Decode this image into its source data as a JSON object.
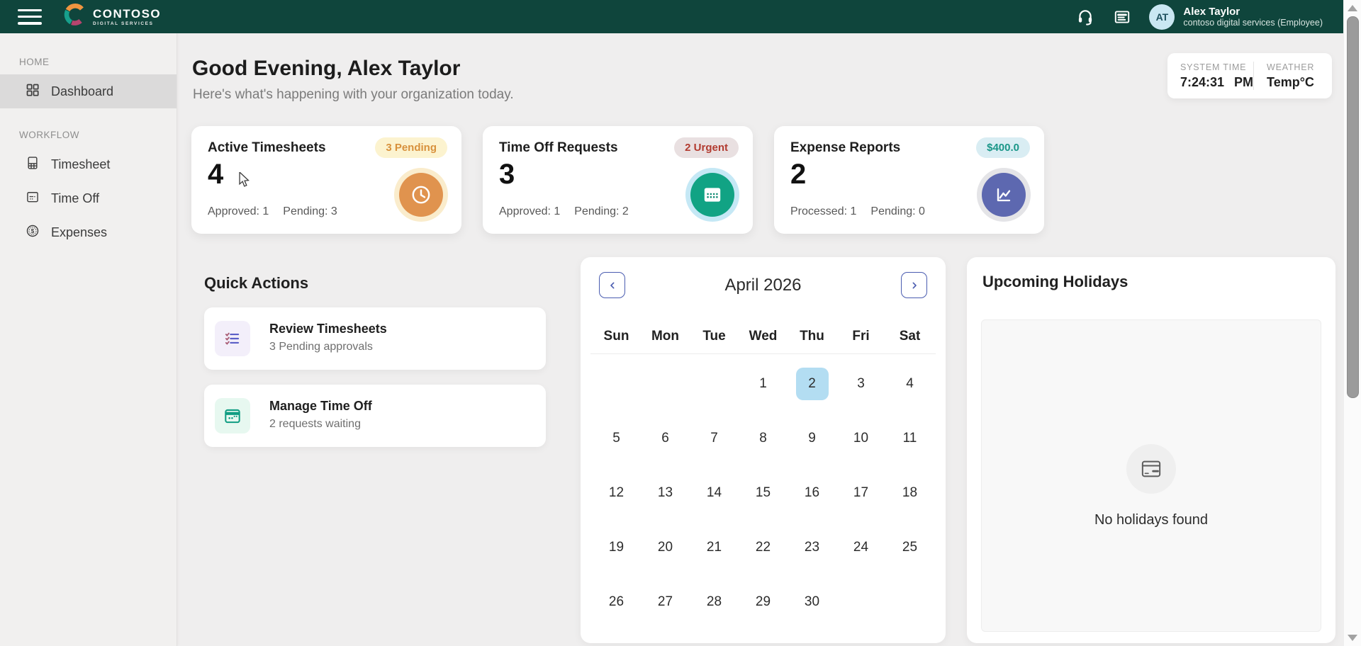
{
  "topbar": {
    "logo_name": "CONTOSO",
    "logo_tagline": "DIGITAL SERVICES",
    "user": {
      "initials": "AT",
      "name": "Alex Taylor",
      "role": "contoso digital services (Employee)"
    }
  },
  "sidebar": {
    "sections": [
      {
        "label": "HOME"
      },
      {
        "label": "WORKFLOW"
      }
    ],
    "items": {
      "dashboard": "Dashboard",
      "timesheet": "Timesheet",
      "timeoff": "Time Off",
      "expenses": "Expenses"
    }
  },
  "header": {
    "greeting": "Good Evening, Alex Taylor",
    "subtitle": "Here's what's happening with your organization today."
  },
  "status_widget": {
    "system_time_label": "SYSTEM TIME",
    "time_value": "7:24:31",
    "meridiem": "PM",
    "weather_label": "WEATHER",
    "weather_value": "Temp°C"
  },
  "stat_cards": [
    {
      "title": "Active Timesheets",
      "badge": "3 Pending",
      "badge_bg": "#fcf3cf",
      "badge_color": "#d8913c",
      "value": "4",
      "detail_left": "Approved: 1",
      "detail_right": "Pending: 3",
      "icon": "clock-icon",
      "icon_bg": "#e0934e",
      "ring": "rgba(245,221,163,0.55)"
    },
    {
      "title": "Time Off Requests",
      "badge": "2 Urgent",
      "badge_bg": "#e9e0e1",
      "badge_color": "#b23b30",
      "value": "3",
      "detail_left": "Approved: 1",
      "detail_right": "Pending: 2",
      "icon": "calendar-icon",
      "icon_bg": "#11a384",
      "ring": "rgba(158,217,238,0.6)"
    },
    {
      "title": "Expense Reports",
      "badge": "$400.0",
      "badge_bg": "#d9edf3",
      "badge_color": "#1a9688",
      "value": "2",
      "detail_left": "Processed: 1",
      "detail_right": "Pending: 0",
      "icon": "chart-icon",
      "icon_bg": "#5d68b0",
      "ring": "rgba(206,206,212,0.55)"
    }
  ],
  "quick_actions": {
    "title": "Quick Actions",
    "items": [
      {
        "title": "Review Timesheets",
        "subtitle": "3 Pending approvals",
        "icon": "checklist-icon"
      },
      {
        "title": "Manage Time Off",
        "subtitle": "2 requests waiting",
        "icon": "calendar-plus-icon"
      }
    ]
  },
  "calendar": {
    "title": "April 2026",
    "day_headers": [
      "Sun",
      "Mon",
      "Tue",
      "Wed",
      "Thu",
      "Fri",
      "Sat"
    ],
    "weeks": [
      [
        null,
        null,
        null,
        1,
        2,
        3,
        4
      ],
      [
        5,
        6,
        7,
        8,
        9,
        10,
        11
      ],
      [
        12,
        13,
        14,
        15,
        16,
        17,
        18
      ],
      [
        19,
        20,
        21,
        22,
        23,
        24,
        25
      ],
      [
        26,
        27,
        28,
        29,
        30,
        null,
        null
      ]
    ],
    "selected_day": 2,
    "selected_bg": "#b3ddf2"
  },
  "holidays": {
    "title": "Upcoming Holidays",
    "empty_text": "No holidays found"
  }
}
